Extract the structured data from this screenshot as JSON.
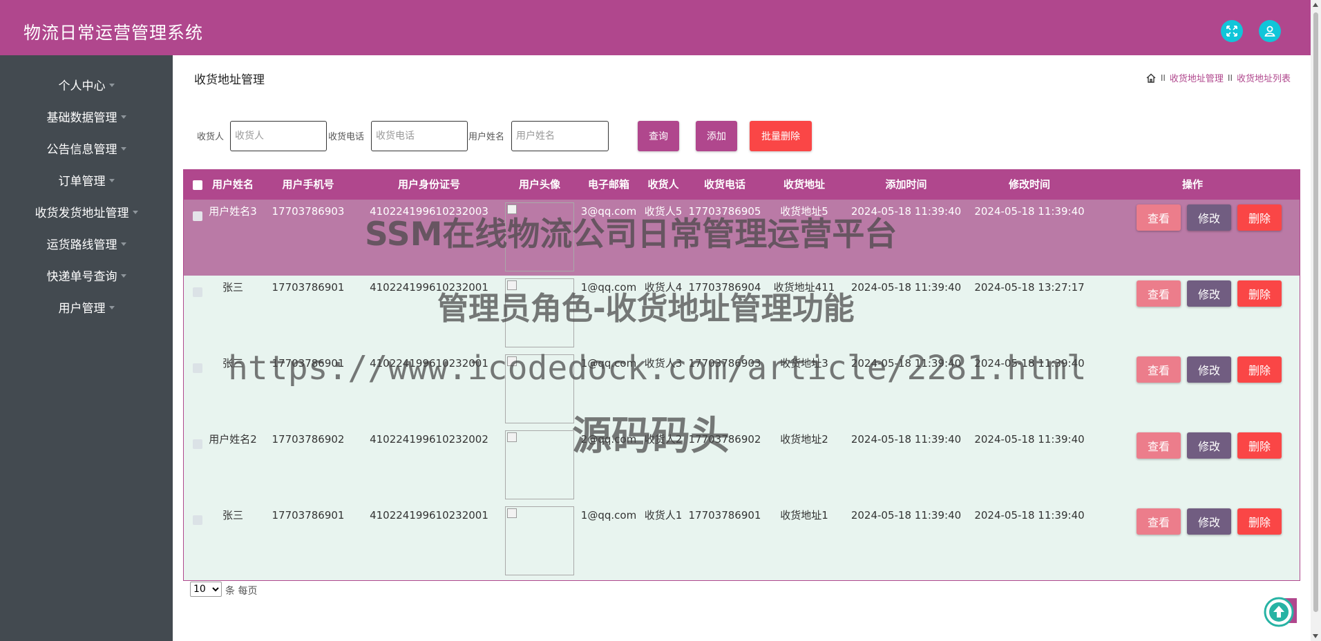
{
  "app": {
    "title": "物流日常运营管理系统"
  },
  "sidebar": {
    "items": [
      {
        "label": "个人中心"
      },
      {
        "label": "基础数据管理"
      },
      {
        "label": "公告信息管理"
      },
      {
        "label": "订单管理"
      },
      {
        "label": "收货发货地址管理"
      },
      {
        "label": "运货路线管理"
      },
      {
        "label": "快递单号查询"
      },
      {
        "label": "用户管理"
      }
    ]
  },
  "page": {
    "title": "收货地址管理",
    "breadcrumb": [
      "收货地址管理",
      "收货地址列表"
    ],
    "breadcrumb_sep": "II"
  },
  "search": {
    "receiver_label": "收货人",
    "receiver_placeholder": "收货人",
    "phone_label": "收货电话",
    "phone_placeholder": "收货电话",
    "username_label": "用户姓名",
    "username_placeholder": "用户姓名",
    "query_button": "查询",
    "add_button": "添加",
    "batch_delete_button": "批量删除"
  },
  "table": {
    "headers": [
      "用户姓名",
      "用户手机号",
      "用户身份证号",
      "用户头像",
      "电子邮箱",
      "收货人",
      "收货电话",
      "收货地址",
      "添加时间",
      "修改时间",
      "操作"
    ],
    "rows": [
      {
        "username": "用户姓名3",
        "phone": "17703786903",
        "id_card": "410224199610232003",
        "email": "3@qq.com",
        "receiver": "收货人5",
        "receiver_phone": "17703786905",
        "address": "收货地址5",
        "created": "2024-05-18 11:39:40",
        "updated": "2024-05-18 11:39:40"
      },
      {
        "username": "张三",
        "phone": "17703786901",
        "id_card": "410224199610232001",
        "email": "1@qq.com",
        "receiver": "收货人4",
        "receiver_phone": "17703786904",
        "address": "收货地址411",
        "created": "2024-05-18 11:39:40",
        "updated": "2024-05-18 13:27:17"
      },
      {
        "username": "张三",
        "phone": "17703786901",
        "id_card": "410224199610232001",
        "email": "1@qq.com",
        "receiver": "收货人3",
        "receiver_phone": "17703786903",
        "address": "收货地址3",
        "created": "2024-05-18 11:39:40",
        "updated": "2024-05-18 11:39:40"
      },
      {
        "username": "用户姓名2",
        "phone": "17703786902",
        "id_card": "410224199610232002",
        "email": "2@qq.com",
        "receiver": "收货人2",
        "receiver_phone": "17703786902",
        "address": "收货地址2",
        "created": "2024-05-18 11:39:40",
        "updated": "2024-05-18 11:39:40"
      },
      {
        "username": "张三",
        "phone": "17703786901",
        "id_card": "410224199610232001",
        "email": "1@qq.com",
        "receiver": "收货人1",
        "receiver_phone": "17703786901",
        "address": "收货地址1",
        "created": "2024-05-18 11:39:40",
        "updated": "2024-05-18 11:39:40"
      }
    ],
    "actions": {
      "view": "查看",
      "edit": "修改",
      "delete": "删除"
    }
  },
  "pagination": {
    "page_size": "10",
    "page_size_label": "条 每页"
  },
  "watermark": {
    "line1": "SSM在线物流公司日常管理运营平台",
    "line2": "管理员角色-收货地址管理功能",
    "line3": "https://www.icodedock.com/article/2281.html",
    "line4": "源码码头"
  },
  "colors": {
    "header": "#b0478d",
    "sidebar": "#434a50",
    "header_icon_button": "#11c5d9",
    "view_button": "#ec7d8b",
    "edit_button": "#715d81",
    "delete_button": "#fa4646",
    "table_row": "#e8f4ef"
  },
  "icons": {
    "fullscreen": "expand-arrows-icon",
    "user": "user-icon",
    "home": "home-icon",
    "back_to_top": "arrow-up-circle-icon"
  }
}
